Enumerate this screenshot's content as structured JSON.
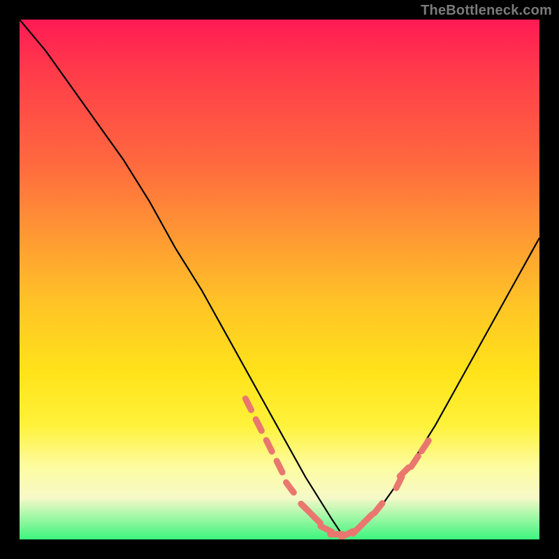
{
  "watermark": "TheBottleneck.com",
  "colors": {
    "background": "#000000",
    "gradient_top": "#ff1a54",
    "gradient_mid1": "#ff9a33",
    "gradient_mid2": "#ffe31a",
    "gradient_low": "#fdfca0",
    "gradient_bottom": "#3cf57e",
    "curve": "#000000",
    "marker": "#e9776f"
  },
  "chart_data": {
    "type": "line",
    "title": "",
    "xlabel": "",
    "ylabel": "",
    "xlim": [
      0,
      100
    ],
    "ylim": [
      0,
      100
    ],
    "grid": false,
    "series": [
      {
        "name": "bottleneck-curve",
        "x": [
          0,
          5,
          10,
          15,
          20,
          25,
          30,
          35,
          40,
          45,
          50,
          55,
          60,
          62,
          65,
          70,
          75,
          80,
          85,
          90,
          95,
          100
        ],
        "y": [
          100,
          94,
          87,
          80,
          73,
          65,
          56,
          48,
          39,
          30,
          21,
          12,
          4,
          1,
          2,
          7,
          14,
          22,
          31,
          40,
          49,
          58
        ]
      }
    ],
    "markers": {
      "name": "highlighted-points",
      "x": [
        44,
        46,
        48,
        50,
        52,
        55,
        57,
        59,
        61,
        63,
        65,
        67,
        69,
        73,
        74,
        76,
        78
      ],
      "y": [
        26,
        22,
        18,
        14,
        10,
        6,
        4,
        2,
        1,
        1,
        2,
        4,
        6,
        11,
        13,
        15,
        18
      ]
    }
  }
}
